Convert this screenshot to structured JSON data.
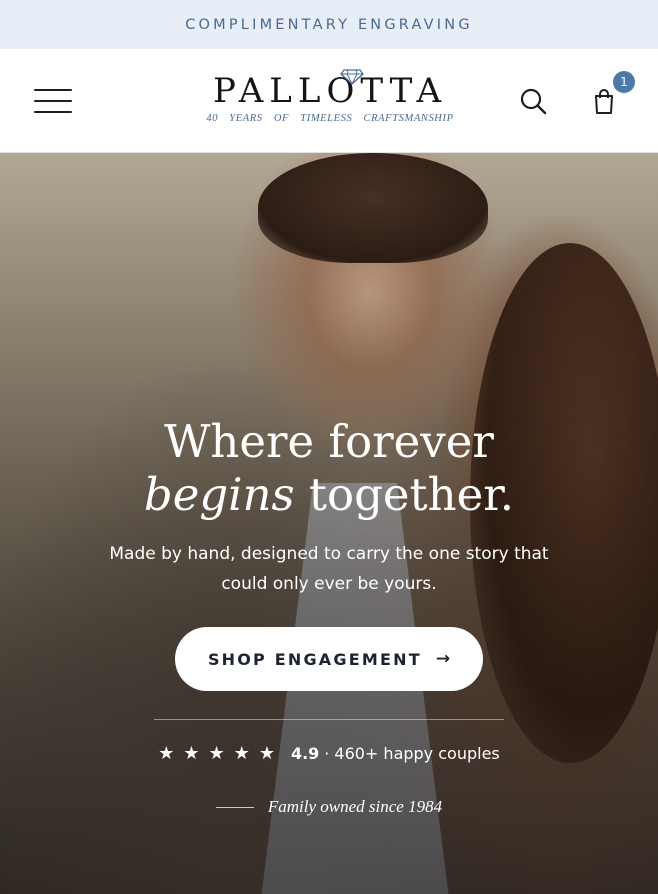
{
  "announcement": "COMPLIMENTARY ENGRAVING",
  "header": {
    "brand": "PALLOTTA",
    "tagline": "40 YEARS OF TIMELESS CRAFTSMANSHIP",
    "menu_icon": "hamburger-menu-icon",
    "search_icon": "search-icon",
    "cart_icon": "shopping-bag-icon",
    "cart_count": "1"
  },
  "hero": {
    "headline_line1": "Where forever",
    "headline_italic": "begins",
    "headline_line2_rest": " together.",
    "subtext": "Made by hand, designed to carry the one story that could only ever be yours.",
    "cta_label": "SHOP ENGAGEMENT",
    "cta_arrow": "→",
    "rating_stars": 5,
    "rating_score": "4.9",
    "rating_separator": "·",
    "rating_text": "460+ happy couples",
    "family_note": "Family owned since 1984"
  },
  "colors": {
    "announcement_bg": "#e8eef8",
    "accent": "#4a6a8c",
    "badge": "#4a7aa8"
  }
}
